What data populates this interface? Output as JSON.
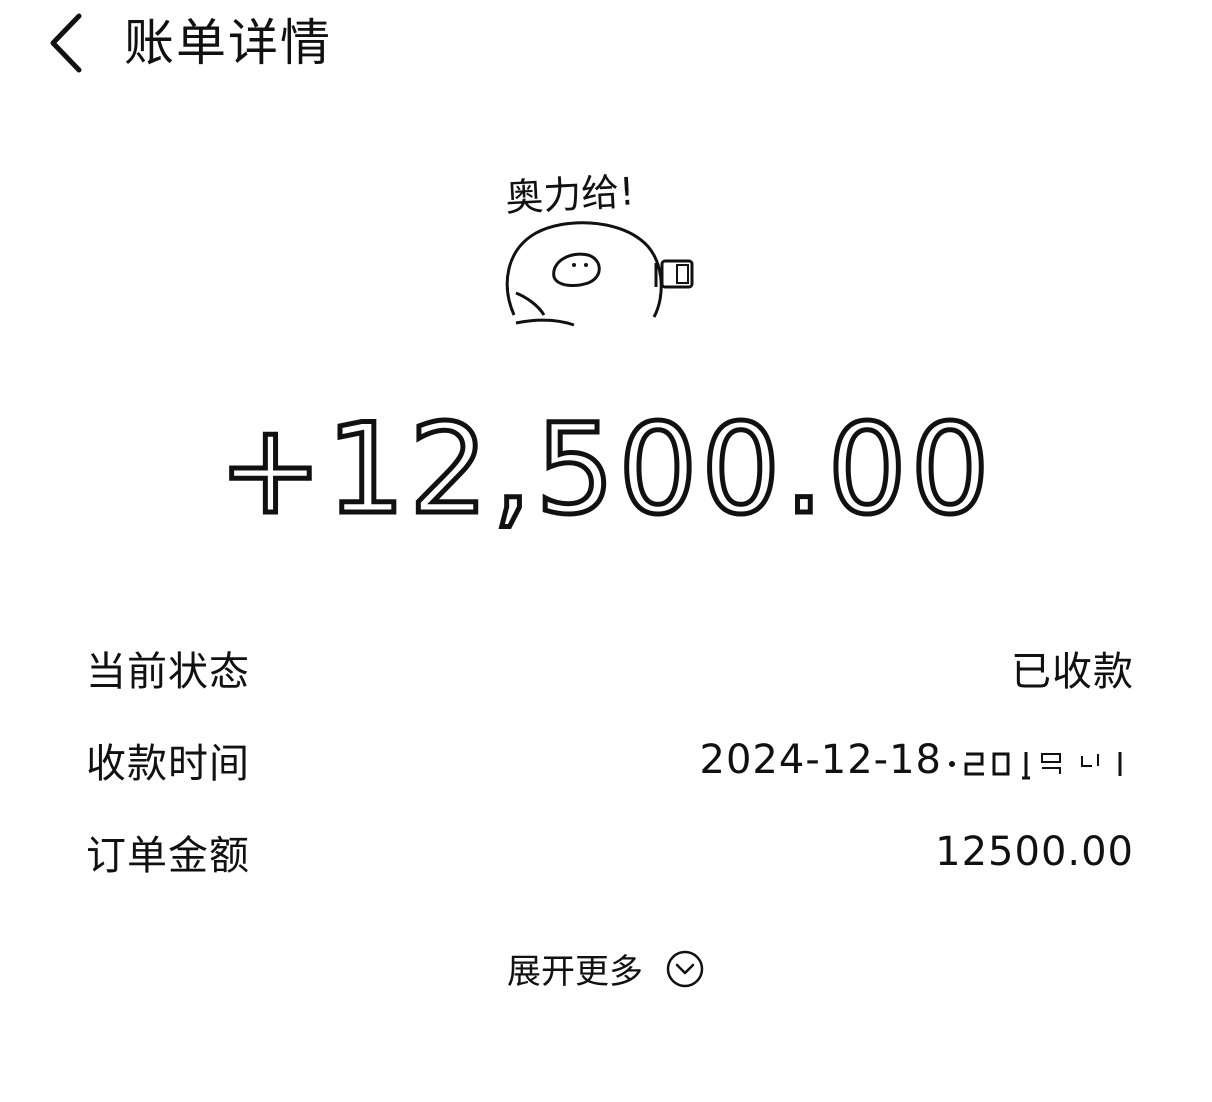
{
  "header": {
    "title": "账单详情",
    "back_icon": "chevron-left-icon"
  },
  "sticker": {
    "caption": "奥力给!",
    "icon": "cartoon-blob-sticker"
  },
  "amount": {
    "value": "+12,500.00"
  },
  "details": {
    "rows": [
      {
        "label": "当前状态",
        "value": "已收款"
      },
      {
        "label": "收款时间",
        "value": "2024-12-18"
      },
      {
        "label": "订单金额",
        "value": "12500.00"
      }
    ]
  },
  "footer": {
    "expand_label": "展开更多",
    "expand_icon": "chevron-down-circle-icon"
  }
}
